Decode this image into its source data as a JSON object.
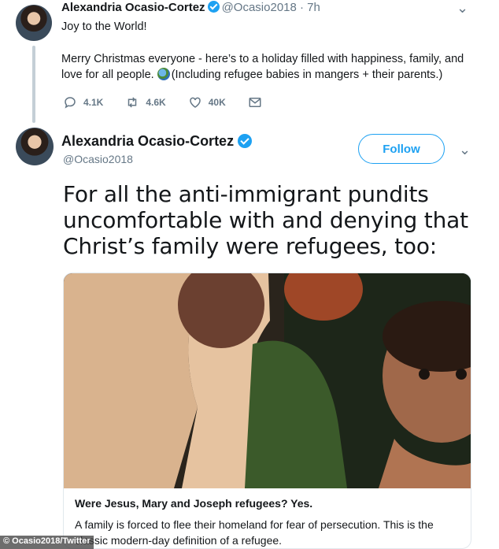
{
  "tweet1": {
    "name": "Alexandria Ocasio-Cortez",
    "handle": "@Ocasio2018",
    "time": "· 7h",
    "line1": "Joy to the World!",
    "line2": "Merry Christmas everyone - here’s to a holiday filled with happiness, family, and",
    "line3": "love for all people.",
    "line3b": "(Including refugee babies in mangers + their parents.)",
    "replies": "4.1K",
    "retweets": "4.6K",
    "likes": "40K",
    "globe_icon": "globe-emoji"
  },
  "tweet2": {
    "name": "Alexandria Ocasio-Cortez",
    "handle": "@Ocasio2018",
    "follow_label": "Follow",
    "body": "For all the anti-immigrant pundits uncomfortable with and denying that Christ’s family were refugees, too:",
    "card": {
      "title": "Were Jesus, Mary and Joseph refugees? Yes.",
      "description": "A family is forced to flee their homeland for fear of persecution. This is the classic modern-day definition of a refugee."
    }
  },
  "watermark": "© Ocasio2018/Twitter",
  "colors": {
    "accent": "#1da1f2",
    "muted": "#657786",
    "text": "#14171a",
    "border": "#e1e8ed"
  }
}
